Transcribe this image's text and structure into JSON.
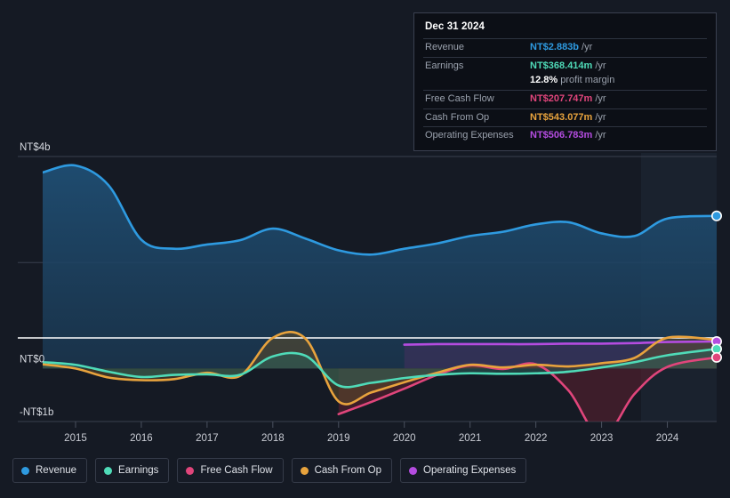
{
  "chart_data": {
    "type": "area",
    "title": "",
    "subtitle": "",
    "xlabel": "",
    "ylabel": "",
    "currency": "NT$",
    "grid": true,
    "legend_position": "bottom",
    "x": [
      2014.5,
      2015,
      2015.5,
      2016,
      2016.5,
      2017,
      2017.5,
      2018,
      2018.5,
      2019,
      2019.5,
      2020,
      2020.5,
      2021,
      2021.5,
      2022,
      2022.5,
      2023,
      2023.5,
      2024,
      2024.75
    ],
    "xlim": [
      2014.5,
      2024.75
    ],
    "ylim": [
      -1.2,
      4.6
    ],
    "y_ticks": [
      {
        "value": 4,
        "label": "NT$4b"
      },
      {
        "value": 2,
        "label": ""
      },
      {
        "value": 0,
        "label": "NT$0"
      },
      {
        "value": -1,
        "label": "-NT$1b"
      }
    ],
    "x_ticks": [
      {
        "value": 2015,
        "label": "2015"
      },
      {
        "value": 2016,
        "label": "2016"
      },
      {
        "value": 2017,
        "label": "2017"
      },
      {
        "value": 2018,
        "label": "2018"
      },
      {
        "value": 2019,
        "label": "2019"
      },
      {
        "value": 2020,
        "label": "2020"
      },
      {
        "value": 2021,
        "label": "2021"
      },
      {
        "value": 2022,
        "label": "2022"
      },
      {
        "value": 2023,
        "label": "2023"
      },
      {
        "value": 2024,
        "label": "2024"
      }
    ],
    "series": [
      {
        "name": "Revenue",
        "color": "#2e9ae0",
        "fill": "#1d4463",
        "values": [
          3.7,
          3.83,
          3.46,
          2.43,
          2.26,
          2.34,
          2.42,
          2.64,
          2.45,
          2.23,
          2.15,
          2.26,
          2.36,
          2.5,
          2.58,
          2.72,
          2.76,
          2.55,
          2.5,
          2.83,
          2.88
        ]
      },
      {
        "name": "Earnings",
        "color": "#4fdbb8",
        "fill": "#2a5f57",
        "values": [
          0.12,
          0.07,
          -0.06,
          -0.16,
          -0.12,
          -0.11,
          -0.12,
          0.23,
          0.24,
          -0.32,
          -0.27,
          -0.18,
          -0.12,
          -0.09,
          -0.1,
          -0.09,
          -0.06,
          0.02,
          0.12,
          0.25,
          0.37
        ]
      },
      {
        "name": "Free Cash Flow",
        "color": "#e0457b",
        "fill": "#5e2130",
        "values": [
          null,
          null,
          null,
          null,
          null,
          null,
          null,
          null,
          null,
          -0.86,
          -0.63,
          -0.38,
          -0.12,
          0.06,
          -0.01,
          0.08,
          -0.42,
          -1.3,
          -0.48,
          0.03,
          0.21
        ]
      },
      {
        "name": "Cash From Op",
        "color": "#e8a33d",
        "fill": "#5c4a2a",
        "values": [
          0.08,
          0.0,
          -0.17,
          -0.22,
          -0.2,
          -0.08,
          -0.14,
          0.58,
          0.56,
          -0.62,
          -0.45,
          -0.26,
          -0.08,
          0.07,
          0.02,
          0.07,
          0.04,
          0.1,
          0.2,
          0.58,
          0.54
        ]
      },
      {
        "name": "Operating Expenses",
        "color": "#b44ce0",
        "fill": "#45305e",
        "values": [
          null,
          null,
          null,
          null,
          null,
          null,
          null,
          null,
          null,
          null,
          null,
          0.45,
          0.46,
          0.46,
          0.46,
          0.46,
          0.47,
          0.47,
          0.48,
          0.5,
          0.51
        ]
      }
    ],
    "endpoint_markers": [
      {
        "series": "Revenue",
        "value": 2.88
      },
      {
        "series": "Operating Expenses",
        "value": 0.51
      },
      {
        "series": "Earnings",
        "value": 0.37
      },
      {
        "series": "Free Cash Flow",
        "value": 0.21
      }
    ],
    "highlight_band": {
      "from": 2023.6,
      "to": 2024.75
    }
  },
  "tooltip": {
    "date": "Dec 31 2024",
    "rows": [
      {
        "label": "Revenue",
        "value": "NT$2.883b",
        "suffix": "/yr",
        "color": "#2e9ae0"
      },
      {
        "label": "Earnings",
        "value": "NT$368.414m",
        "suffix": "/yr",
        "color": "#4fdbb8"
      },
      {
        "label": "",
        "value": "12.8%",
        "suffix": "profit margin",
        "color": "#ffffff"
      },
      {
        "label": "Free Cash Flow",
        "value": "NT$207.747m",
        "suffix": "/yr",
        "color": "#e0457b"
      },
      {
        "label": "Cash From Op",
        "value": "NT$543.077m",
        "suffix": "/yr",
        "color": "#e8a33d"
      },
      {
        "label": "Operating Expenses",
        "value": "NT$506.783m",
        "suffix": "/yr",
        "color": "#b44ce0"
      }
    ]
  },
  "legend": {
    "items": [
      {
        "label": "Revenue",
        "color": "#2e9ae0"
      },
      {
        "label": "Earnings",
        "color": "#4fdbb8"
      },
      {
        "label": "Free Cash Flow",
        "color": "#e0457b"
      },
      {
        "label": "Cash From Op",
        "color": "#e8a33d"
      },
      {
        "label": "Operating Expenses",
        "color": "#b44ce0"
      }
    ]
  }
}
